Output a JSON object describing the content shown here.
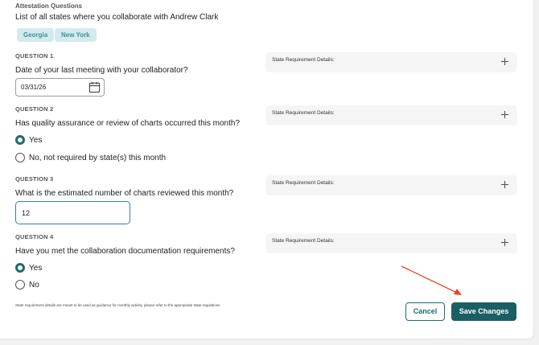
{
  "header": {
    "section_title": "Attestation Questions",
    "intro": "List of all states where you collaborate with Andrew Clark",
    "states": [
      "Georgia",
      "New York"
    ]
  },
  "questions": [
    {
      "label": "QUESTION 1",
      "text": "Date of your last meeting with your collaborator?",
      "input_value": "03/31/26",
      "requirement_label": "State Requirement Details:"
    },
    {
      "label": "QUESTION 2",
      "text": "Has quality assurance or review of charts occurred this month?",
      "options": [
        "Yes",
        "No, not required by state(s) this month"
      ],
      "selected": "Yes",
      "requirement_label": "State Requirement Details:"
    },
    {
      "label": "QUESTION 3",
      "text": "What is the estimated number of charts reviewed this month?",
      "input_value": "12",
      "requirement_label": "State Requirement Details:"
    },
    {
      "label": "QUESTION 4",
      "text": "Have you met the collaboration documentation requirements?",
      "options": [
        "Yes",
        "No"
      ],
      "selected": "Yes",
      "requirement_label": "State Requirement Details:"
    }
  ],
  "footer": {
    "note": "State requirement details are meant to be used as guidance for monthly activity, please refer to the appropriate state regulations",
    "cancel_label": "Cancel",
    "save_label": "Save Changes"
  },
  "colors": {
    "accent": "#1a5f64",
    "chip_bg": "#d3ebee",
    "chip_text": "#3f8f97",
    "arrow": "#e8432a"
  },
  "icons": {
    "date": "calendar-icon",
    "expand": "plus-icon",
    "annotation": "red-arrow-icon"
  }
}
